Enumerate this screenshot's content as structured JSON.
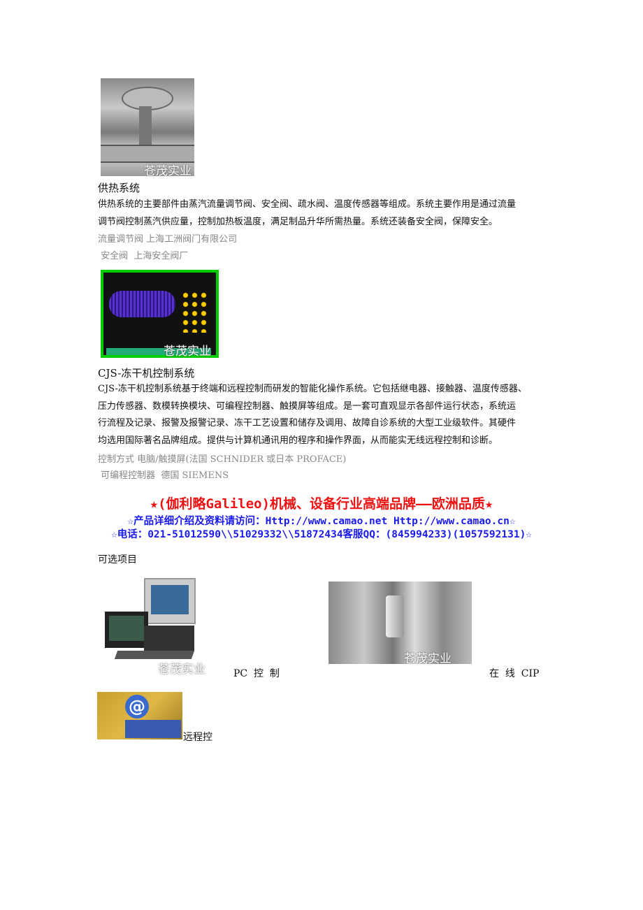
{
  "watermark": "苍茂实业",
  "section1": {
    "title": "供热系统",
    "body": [
      "供热系统的主要部件由蒸汽流量调节阀、安全阀、疏水阀、温度传感器等组成。系统主要作用是通过流量",
      "调节阀控制蒸汽供应量，控制加热板温度，满足制品升华所需热量。系统还装备安全阀，保障安全。"
    ],
    "specs": [
      "流量调节阀  上海工洲阀门有限公司",
      " 安全阀  上海安全阀厂"
    ]
  },
  "section2": {
    "title": "CJS-冻干机控制系统",
    "body": [
      "CJS-冻干机控制系统基于终端和远程控制而研发的智能化操作系统。它包括继电器、接触器、温度传感器、",
      "压力传感器、数模转换模块、可编程控制器、触摸屏等组成。是一套可直观显示各部件运行状态，系统运",
      "行流程及记录、报警及报警记录、冻干工艺设置和储存及调用、故障自诊系统的大型工业级软件。其硬件",
      "均选用国际著名品牌组成。提供与计算机通讯用的程序和操作界面，从而能实无线远程控制和诊断。"
    ],
    "specs": [
      "控制方式  电脑/触摸屏(法国 SCHNIDER 或日本 PROFACE)",
      " 可编程控制器  德国 SIEMENS"
    ]
  },
  "banner": {
    "line1": "★(伽利略Galileo)机械、设备行业高端品牌——欧洲品质★",
    "line2": "☆产品详细介绍及资料请访问：Http://www.camao.net Http://www.camao.cn☆",
    "line3": "☆电话：021-51012590\\\\51029332\\\\51872434客服QQ：(845994233)(1057592131)☆",
    "colors": {
      "line1": "#ee1111",
      "line2": "#1a1aee",
      "line3": "#1a1aee"
    }
  },
  "options": {
    "title": "可选项目",
    "items": [
      "PC  控  制",
      "在  线  CIP",
      "远程控"
    ]
  }
}
